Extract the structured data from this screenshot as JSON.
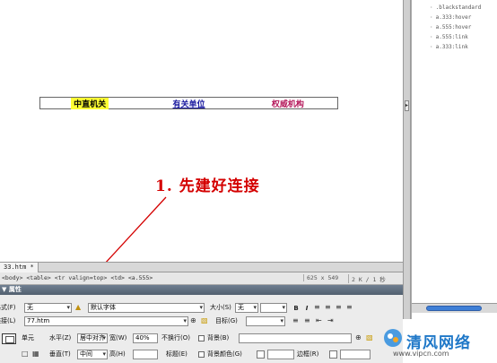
{
  "canvas": {
    "nav_links": [
      "中直机关",
      "有关单位",
      "权威机构"
    ],
    "note": "1. 先建好连接"
  },
  "css_panel": {
    "styles": [
      ".blackstandard",
      "a.333:hover",
      "a.555:hover",
      "a.555:link",
      "a.333:link"
    ]
  },
  "document": {
    "tab_label": "33.htm *",
    "tag_selector": "<body> <table> <tr valign=top> <td> <a.555>",
    "window_size": "625 x 549",
    "download_info": "2 K / 1 秒"
  },
  "properties": {
    "title": "▼ 属性",
    "format_label": "格式(F)",
    "format_value": "无",
    "style_value": "默认字体",
    "size_label": "大小(S)",
    "size_value": "无",
    "link_label": "链接(L)",
    "link_value": "77.htm",
    "target_label": "目标(G)",
    "cell_label": "单元",
    "horz_label": "水平(Z)",
    "horz_value": "居中对齐",
    "width_label": "宽(W)",
    "width_value": "40%",
    "nowrap_label": "不换行(O)",
    "bg_label": "背景(B)",
    "vert_label": "垂直(T)",
    "vert_value": "中间",
    "height_label": "高(H)",
    "header_label": "标题(E)",
    "bgcolor_label": "背景颜色(G)",
    "border_label": "边框(R)"
  },
  "brand": {
    "name": "清风网络",
    "url": "www.vipcn.com"
  },
  "colors": {
    "note": "#d40000",
    "highlight": "#ffff33",
    "panel_header": "#52606f",
    "brand": "#1f78c8"
  }
}
